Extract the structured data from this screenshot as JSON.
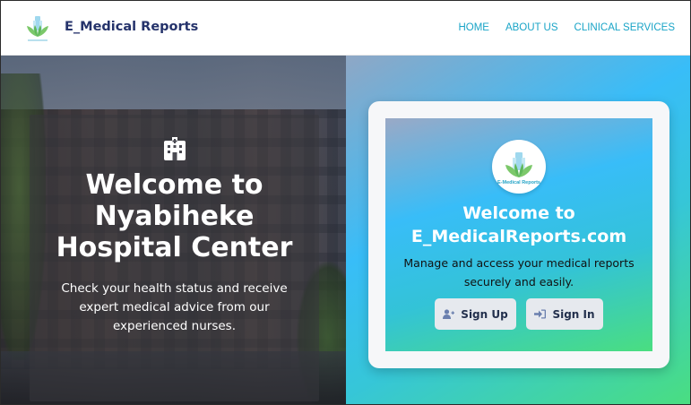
{
  "navbar": {
    "brand_name": "E_Medical Reports",
    "logo_icon": "lotus-logo-icon",
    "links": [
      "HOME",
      "ABOUT US",
      "CLINICAL SERVICES"
    ]
  },
  "hero_left": {
    "icon": "hospital-icon",
    "title_lines": [
      "Welcome to",
      "Nyabiheke",
      "Hospital Center"
    ],
    "text": "Check your health status and receive expert medical advice from our experienced nurses."
  },
  "card": {
    "logo_text": "E-Medical Reports",
    "title_lines": [
      "Welcome to",
      "E_MedicalReports.com"
    ],
    "text": "Manage and access your medical reports securely and easily.",
    "signup_label": "Sign Up",
    "signup_icon": "user-plus-icon",
    "signin_label": "Sign In",
    "signin_icon": "sign-in-icon"
  },
  "colors": {
    "brand": "#25336b",
    "nav_link": "#19a4c7",
    "gradient_start": "#38bdf8",
    "gradient_end": "#4ade80",
    "button_bg": "#e6e9ee"
  }
}
